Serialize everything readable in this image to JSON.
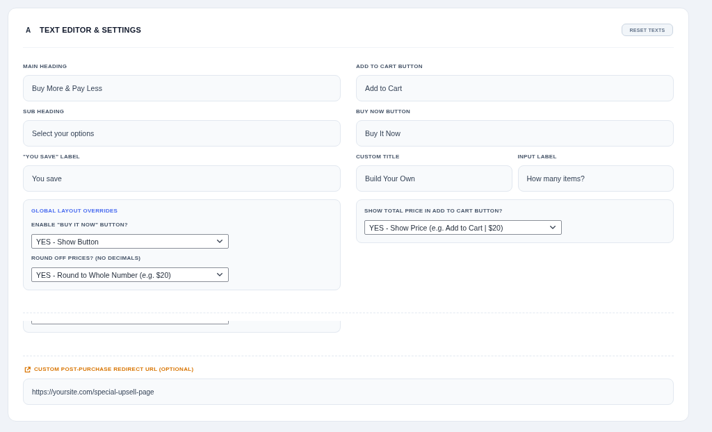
{
  "header": {
    "icon": "A",
    "title": "TEXT EDITOR & SETTINGS",
    "reset_button": "RESET TEXTS"
  },
  "text_fields": [
    {
      "rows": [
        {
          "fields": [
            {
              "label": "MAIN HEADING",
              "value": "Buy More & Pay Less"
            }
          ]
        },
        {
          "fields": [
            {
              "label": "SUB HEADING",
              "value": "Select your options"
            }
          ]
        },
        {
          "fields": [
            {
              "label": "\"YOU SAVE\" LABEL",
              "value": "You save"
            }
          ]
        }
      ]
    },
    {
      "rows": [
        {
          "fields": [
            {
              "label": "ADD TO CART BUTTON",
              "value": "Add to Cart"
            }
          ]
        },
        {
          "fields": [
            {
              "label": "BUY NOW BUTTON",
              "value": "Buy It Now"
            }
          ]
        },
        {
          "fields": [
            {
              "label": "CUSTOM TITLE",
              "value": "Build Your Own"
            },
            {
              "label": "INPUT LABEL",
              "value": "How many items?"
            }
          ]
        }
      ]
    }
  ],
  "override_panels": [
    {
      "heading": "GLOBAL LAYOUT OVERRIDES",
      "settings": [
        {
          "label": "ENABLE \"BUY IT NOW\" BUTTON?",
          "value": "YES - Show Button"
        },
        {
          "label": "ROUND OFF PRICES? (NO DECIMALS)",
          "value": "YES - Round to Whole Number (e.g. $20)"
        }
      ]
    },
    {
      "settings": [
        {
          "label": "SHOW TOTAL PRICE IN ADD TO CART BUTTON?",
          "value": "YES - Show Price (e.g. Add to Cart | $20)"
        }
      ]
    }
  ],
  "redirect": {
    "label": "CUSTOM POST-PURCHASE REDIRECT URL (OPTIONAL)",
    "value": "https://yoursite.com/special-upsell-page"
  }
}
